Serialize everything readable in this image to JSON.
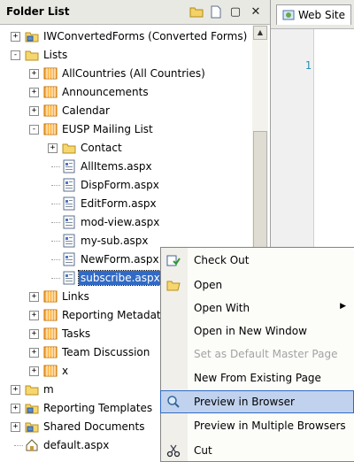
{
  "panel": {
    "title": "Folder List"
  },
  "editor": {
    "tab_label": "Web Site",
    "line_number": "1"
  },
  "tree": [
    {
      "label": "IWConvertedForms (Converted Forms)",
      "icon": "site-folder-icon",
      "expander": "+"
    },
    {
      "label": "Lists",
      "icon": "folder-icon",
      "expander": "-"
    },
    {
      "label": "AllCountries (All Countries)",
      "icon": "list-icon",
      "expander": "+"
    },
    {
      "label": "Announcements",
      "icon": "list-icon",
      "expander": "+"
    },
    {
      "label": "Calendar",
      "icon": "list-icon",
      "expander": "+"
    },
    {
      "label": "EUSP Mailing List",
      "icon": "list-icon",
      "expander": "-"
    },
    {
      "label": "Contact",
      "icon": "folder-icon",
      "expander": "+"
    },
    {
      "label": "AllItems.aspx",
      "icon": "aspx-file-icon"
    },
    {
      "label": "DispForm.aspx",
      "icon": "aspx-file-icon"
    },
    {
      "label": "EditForm.aspx",
      "icon": "aspx-file-icon"
    },
    {
      "label": "mod-view.aspx",
      "icon": "aspx-file-icon"
    },
    {
      "label": "my-sub.aspx",
      "icon": "aspx-file-icon"
    },
    {
      "label": "NewForm.aspx",
      "icon": "aspx-file-icon"
    },
    {
      "label": "subscribe.aspx",
      "icon": "aspx-file-icon",
      "selected": true
    },
    {
      "label": "Links",
      "icon": "list-icon",
      "expander": "+"
    },
    {
      "label": "Reporting Metadata",
      "icon": "list-icon",
      "expander": "+"
    },
    {
      "label": "Tasks",
      "icon": "list-icon",
      "expander": "+"
    },
    {
      "label": "Team Discussion",
      "icon": "list-icon",
      "expander": "+"
    },
    {
      "label": "x",
      "icon": "list-icon",
      "expander": "+"
    },
    {
      "label": "m",
      "icon": "folder-icon",
      "expander": "+"
    },
    {
      "label": "Reporting Templates",
      "icon": "site-folder-icon",
      "expander": "+"
    },
    {
      "label": "Shared Documents",
      "icon": "site-folder-icon",
      "expander": "+"
    },
    {
      "label": "default.aspx",
      "icon": "home-page-icon"
    }
  ],
  "menu": {
    "items": [
      {
        "label": "Check Out",
        "icon": "check-out-icon"
      },
      {
        "label": "Open",
        "icon": "open-folder-icon"
      },
      {
        "label": "Open With",
        "submenu": true
      },
      {
        "label": "Open in New Window"
      },
      {
        "label": "Set as Default Master Page",
        "disabled": true
      },
      {
        "label": "New From Existing Page"
      },
      {
        "label": "Preview in Browser",
        "icon": "preview-icon",
        "highlighted": true
      },
      {
        "label": "Preview in Multiple Browsers"
      },
      {
        "label": "Cut",
        "icon": "scissors-icon"
      }
    ]
  }
}
